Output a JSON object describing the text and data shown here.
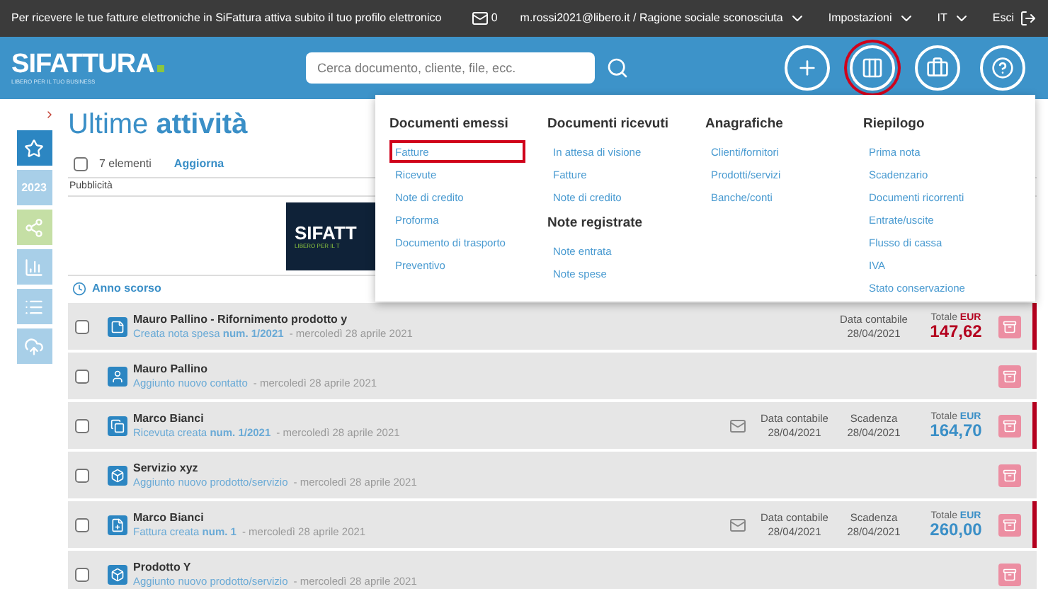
{
  "top_bar": {
    "notice": "Per ricevere le tue fatture elettroniche in SiFattura attiva subito il tuo profilo elettronico",
    "messages": "0",
    "account": "m.rossi2021@libero.it / Ragione sociale sconosciuta",
    "settings": "Impostazioni",
    "language": "IT",
    "logout": "Esci"
  },
  "header": {
    "logo": "SIFATTURA",
    "tagline": "LIBERO PER IL TUO BUSINESS",
    "search": {
      "placeholder": "Cerca documento, cliente, file, ecc."
    },
    "actions": [
      {
        "kind": "plus",
        "selected": false
      },
      {
        "kind": "columns",
        "selected": true
      },
      {
        "kind": "briefcase",
        "selected": false
      },
      {
        "kind": "help",
        "selected": false
      }
    ]
  },
  "sidebar": [
    {
      "kind": "star",
      "selected": true
    },
    {
      "kind": "text",
      "label": "2023",
      "selected": false
    },
    {
      "kind": "share",
      "selected": false
    },
    {
      "kind": "chart",
      "selected": false
    },
    {
      "kind": "list",
      "selected": false
    },
    {
      "kind": "upload",
      "selected": false
    }
  ],
  "title": "Ultime **attività**",
  "toolbar": {
    "count": "7 elementi",
    "checked": false,
    "refresh": "Aggiorna"
  },
  "ad": {
    "label": "Pubblicità",
    "logo": "SIFATT",
    "tagline": "LIBERO PER IL T"
  },
  "group": "Anno scorso",
  "rows": [
    {
      "kind": "note",
      "checked": false,
      "title": "Mauro Pallino - Rifornimento prodotto y",
      "action": "Creata nota spesa **num. 1/2021**",
      "date": "- mercoledì 28 aprile 2021",
      "flagged": true,
      "mail": false,
      "fields": [
        {
          "label": "Data contabile",
          "value": "28/04/2021"
        }
      ],
      "total": {
        "label": "Totale",
        "currency": "EUR",
        "amount": "147,62",
        "kind": "expense"
      }
    },
    {
      "kind": "contact",
      "checked": false,
      "title": "Mauro Pallino",
      "action": "Aggiunto nuovo contatto",
      "date": "- mercoledì 28 aprile 2021",
      "flagged": false,
      "mail": false,
      "fields": []
    },
    {
      "kind": "receipt",
      "checked": false,
      "title": "Marco Bianci",
      "action": "Ricevuta creata **num. 1/2021**",
      "date": "- mercoledì 28 aprile 2021",
      "flagged": true,
      "mail": true,
      "fields": [
        {
          "label": "Data contabile",
          "value": "28/04/2021"
        },
        {
          "label": "Scadenza",
          "value": "28/04/2021"
        }
      ],
      "total": {
        "label": "Totale",
        "currency": "EUR",
        "amount": "164,70",
        "kind": "income"
      }
    },
    {
      "kind": "product",
      "checked": false,
      "title": "Servizio xyz",
      "action": "Aggiunto nuovo prodotto/servizio",
      "date": "- mercoledì 28 aprile 2021",
      "flagged": false,
      "mail": false,
      "fields": []
    },
    {
      "kind": "invoice",
      "checked": false,
      "title": "Marco Bianci",
      "action": "Fattura creata **num. 1**",
      "date": "- mercoledì 28 aprile 2021",
      "flagged": true,
      "mail": true,
      "fields": [
        {
          "label": "Data contabile",
          "value": "28/04/2021"
        },
        {
          "label": "Scadenza",
          "value": "28/04/2021"
        }
      ],
      "total": {
        "label": "Totale",
        "currency": "EUR",
        "amount": "260,00",
        "kind": "income"
      }
    },
    {
      "kind": "product",
      "checked": false,
      "title": "Prodotto Y",
      "action": "Aggiunto nuovo prodotto/servizio",
      "date": "- mercoledì 28 aprile 2021",
      "flagged": false,
      "mail": false,
      "fields": []
    }
  ],
  "menu": {
    "columns": [
      {
        "sections": [
          {
            "heading": "Documenti emessi",
            "items": [
              {
                "label": "Fatture",
                "selected": true
              },
              {
                "label": "Ricevute",
                "selected": false
              },
              {
                "label": "Note di credito",
                "selected": false
              },
              {
                "label": "Proforma",
                "selected": false
              },
              {
                "label": "Documento di trasporto",
                "selected": false
              },
              {
                "label": "Preventivo",
                "selected": false
              }
            ]
          }
        ]
      },
      {
        "sections": [
          {
            "heading": "Documenti ricevuti",
            "items": [
              {
                "label": "In attesa di visione",
                "selected": false
              },
              {
                "label": "Fatture",
                "selected": false
              },
              {
                "label": "Note di credito",
                "selected": false
              }
            ]
          },
          {
            "heading": "Note registrate",
            "items": [
              {
                "label": "Note entrata",
                "selected": false
              },
              {
                "label": "Note spese",
                "selected": false
              }
            ]
          }
        ]
      },
      {
        "sections": [
          {
            "heading": "Anagrafiche",
            "items": [
              {
                "label": "Clienti/fornitori",
                "selected": false
              },
              {
                "label": "Prodotti/servizi",
                "selected": false
              },
              {
                "label": "Banche/conti",
                "selected": false
              }
            ]
          }
        ]
      },
      {
        "sections": [
          {
            "heading": "Riepilogo",
            "items": [
              {
                "label": "Prima nota",
                "selected": false
              },
              {
                "label": "Scadenzario",
                "selected": false
              },
              {
                "label": "Documenti ricorrenti",
                "selected": false
              },
              {
                "label": "Entrate/uscite",
                "selected": false
              },
              {
                "label": "Flusso di cassa",
                "selected": false
              },
              {
                "label": "IVA",
                "selected": false
              },
              {
                "label": "Stato conservazione",
                "selected": false
              }
            ]
          }
        ]
      }
    ]
  }
}
